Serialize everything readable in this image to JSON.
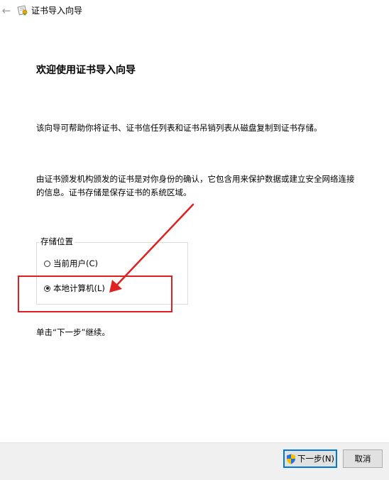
{
  "window": {
    "title": "证书导入向导",
    "back_glyph": "←",
    "icons": [
      "back-arrow-icon",
      "certificate-icon"
    ]
  },
  "content": {
    "heading": "欢迎使用证书导入向导",
    "intro": "该向导可帮助你将证书、证书信任列表和证书吊销列表从磁盘复制到证书存储。",
    "description": "由证书颁发机构颁发的证书是对你身份的确认，它包含用来保护数据或建立安全网络连接的信息。证书存储是保存证书的系统区域。",
    "storage_location": {
      "label": "存储位置",
      "options": [
        {
          "label": "当前用户(C)",
          "selected": false
        },
        {
          "label": "本地计算机(L)",
          "selected": true
        }
      ]
    },
    "continue_hint": "单击“下一步”继续。"
  },
  "footer": {
    "next_label": "下一步(N)",
    "next_icon": "uac-shield-icon",
    "cancel_label": "取消"
  },
  "annotation": {
    "color": "#e02020",
    "target": "本地计算机(L)"
  }
}
